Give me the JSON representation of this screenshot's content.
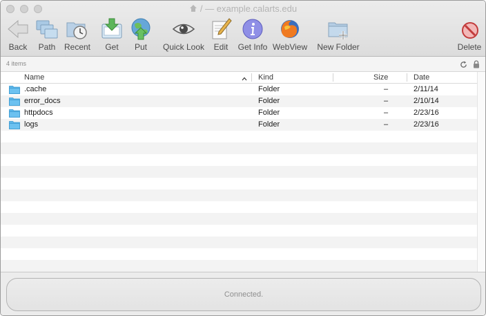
{
  "window": {
    "title": "/ — example.calarts.edu"
  },
  "toolbar": {
    "back": "Back",
    "path": "Path",
    "recent": "Recent",
    "get": "Get",
    "put": "Put",
    "quick_look": "Quick Look",
    "edit": "Edit",
    "get_info": "Get Info",
    "webview": "WebView",
    "new_folder": "New Folder",
    "delete": "Delete"
  },
  "infobar": {
    "item_count": "4 items"
  },
  "table": {
    "columns": {
      "name": "Name",
      "kind": "Kind",
      "size": "Size",
      "date": "Date"
    },
    "rows": [
      {
        "name": ".cache",
        "kind": "Folder",
        "size": "–",
        "date": "2/11/14"
      },
      {
        "name": "error_docs",
        "kind": "Folder",
        "size": "–",
        "date": "2/10/14"
      },
      {
        "name": "httpdocs",
        "kind": "Folder",
        "size": "–",
        "date": "2/23/16"
      },
      {
        "name": "logs",
        "kind": "Folder",
        "size": "–",
        "date": "2/23/16"
      }
    ]
  },
  "status": {
    "text": "Connected."
  },
  "icons": {
    "folder_color": "#5bb6ea",
    "back": "left-arrow-icon",
    "path": "folder-stack-icon",
    "recent": "clock-folder-icon",
    "get": "download-tray-icon",
    "put": "upload-globe-icon",
    "quick_look": "eye-icon",
    "edit": "pencil-paper-icon",
    "get_info": "info-icon",
    "webview": "firefox-globe-icon",
    "new_folder": "new-folder-icon",
    "delete": "delete-circle-icon"
  }
}
